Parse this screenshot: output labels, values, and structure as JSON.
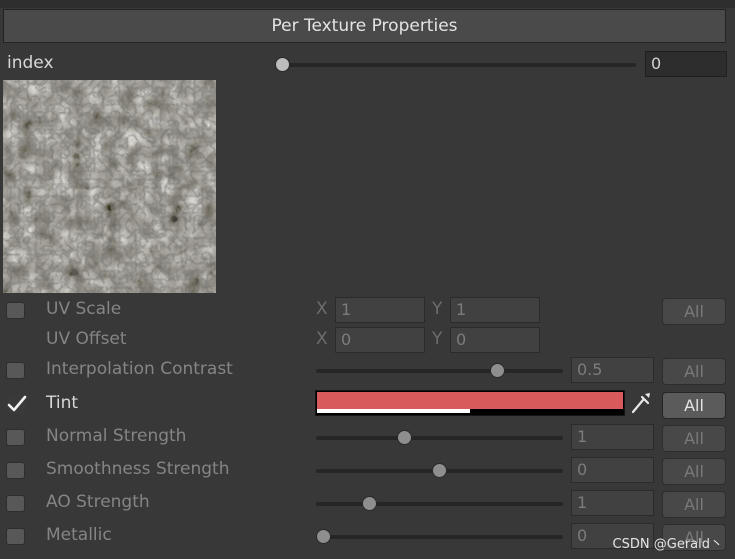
{
  "header": {
    "title": "Per Texture Properties"
  },
  "index": {
    "label": "index",
    "value": "0",
    "level": 0
  },
  "thumbnail": {
    "icon": "rock-texture-thumbnail"
  },
  "uv_scale": {
    "label": "UV Scale",
    "enabled": false,
    "x_axis": "X",
    "x": "1",
    "y_axis": "Y",
    "y": "1",
    "all": "All"
  },
  "uv_offset": {
    "label": "UV Offset",
    "x_axis": "X",
    "x": "0",
    "y_axis": "Y",
    "y": "0"
  },
  "interp": {
    "label": "Interpolation Contrast",
    "enabled": false,
    "value": "0.5",
    "level": 0.75,
    "all": "All"
  },
  "tint": {
    "label": "Tint",
    "enabled": true,
    "color": "#d85a5a",
    "alpha": 0.5,
    "all": "All",
    "picker_icon": "eyedropper-icon"
  },
  "normal": {
    "label": "Normal Strength",
    "enabled": false,
    "value": "1",
    "level": 0.35,
    "all": "All"
  },
  "smooth": {
    "label": "Smoothness Strength",
    "enabled": false,
    "value": "0",
    "level": 0.5,
    "all": "All"
  },
  "ao": {
    "label": "AO Strength",
    "enabled": false,
    "value": "1",
    "level": 0.2,
    "all": "All"
  },
  "metallic": {
    "label": "Metallic",
    "enabled": false,
    "value": "0",
    "level": 0,
    "all": "All"
  },
  "watermark": "CSDN @Gerald丶"
}
